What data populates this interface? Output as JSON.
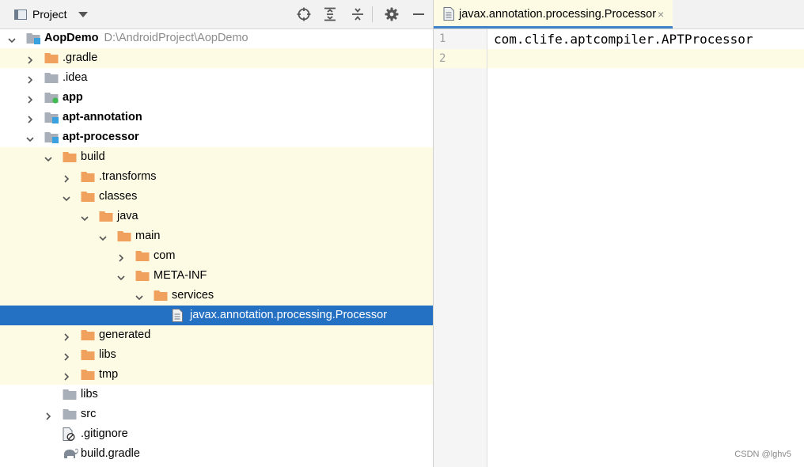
{
  "toolbar": {
    "title": "Project",
    "icons": [
      "crosshair-icon",
      "expand-all-icon",
      "collapse-all-icon",
      "gear-icon",
      "minimize-icon"
    ]
  },
  "tree": [
    {
      "label": "AopDemo",
      "path": "D:\\AndroidProject\\AopDemo",
      "depth": 0,
      "arrow": "down",
      "icon": "module",
      "bold": true,
      "hl": false
    },
    {
      "label": ".gradle",
      "depth": 1,
      "arrow": "right",
      "icon": "folder-orange",
      "bold": false,
      "hl": true
    },
    {
      "label": ".idea",
      "depth": 1,
      "arrow": "right",
      "icon": "folder-gray",
      "bold": false,
      "hl": false
    },
    {
      "label": "app",
      "depth": 1,
      "arrow": "right",
      "icon": "module-app",
      "bold": true,
      "hl": false
    },
    {
      "label": "apt-annotation",
      "depth": 1,
      "arrow": "right",
      "icon": "module",
      "bold": true,
      "hl": false
    },
    {
      "label": "apt-processor",
      "depth": 1,
      "arrow": "down",
      "icon": "module",
      "bold": true,
      "hl": false
    },
    {
      "label": "build",
      "depth": 2,
      "arrow": "down",
      "icon": "folder-orange",
      "bold": false,
      "hl": true
    },
    {
      "label": ".transforms",
      "depth": 3,
      "arrow": "right",
      "icon": "folder-orange",
      "bold": false,
      "hl": true
    },
    {
      "label": "classes",
      "depth": 3,
      "arrow": "down",
      "icon": "folder-orange",
      "bold": false,
      "hl": true
    },
    {
      "label": "java",
      "depth": 4,
      "arrow": "down",
      "icon": "folder-orange",
      "bold": false,
      "hl": true
    },
    {
      "label": "main",
      "depth": 5,
      "arrow": "down",
      "icon": "folder-orange",
      "bold": false,
      "hl": true
    },
    {
      "label": "com",
      "depth": 6,
      "arrow": "right",
      "icon": "folder-orange",
      "bold": false,
      "hl": true
    },
    {
      "label": "META-INF",
      "depth": 6,
      "arrow": "down",
      "icon": "folder-orange",
      "bold": false,
      "hl": true
    },
    {
      "label": "services",
      "depth": 7,
      "arrow": "down",
      "icon": "folder-orange",
      "bold": false,
      "hl": true
    },
    {
      "label": "javax.annotation.processing.Processor",
      "depth": 8,
      "arrow": "none",
      "icon": "text-file",
      "bold": false,
      "hl": false,
      "selected": true
    },
    {
      "label": "generated",
      "depth": 3,
      "arrow": "right",
      "icon": "folder-orange",
      "bold": false,
      "hl": true
    },
    {
      "label": "libs",
      "depth": 3,
      "arrow": "right",
      "icon": "folder-orange",
      "bold": false,
      "hl": true
    },
    {
      "label": "tmp",
      "depth": 3,
      "arrow": "right",
      "icon": "folder-orange",
      "bold": false,
      "hl": true
    },
    {
      "label": "libs",
      "depth": 2,
      "arrow": "none",
      "icon": "folder-gray",
      "bold": false,
      "hl": false
    },
    {
      "label": "src",
      "depth": 2,
      "arrow": "right",
      "icon": "folder-gray",
      "bold": false,
      "hl": false
    },
    {
      "label": ".gitignore",
      "depth": 2,
      "arrow": "none",
      "icon": "gitignore-file",
      "bold": false,
      "hl": false
    },
    {
      "label": "build.gradle",
      "depth": 2,
      "arrow": "none",
      "icon": "gradle-elephant",
      "bold": false,
      "hl": false
    }
  ],
  "editor": {
    "tab_label": "javax.annotation.processing.Processor",
    "close_glyph": "×",
    "lines": [
      "com.clife.aptcompiler.APTProcessor",
      ""
    ],
    "line_numbers": [
      "1",
      "2"
    ]
  },
  "watermark": "CSDN @lghv5",
  "colors": {
    "folder_orange": "#f0a15e",
    "folder_gray": "#a8afb8",
    "selection": "#2470c2",
    "highlight": "#fdfbe4"
  }
}
